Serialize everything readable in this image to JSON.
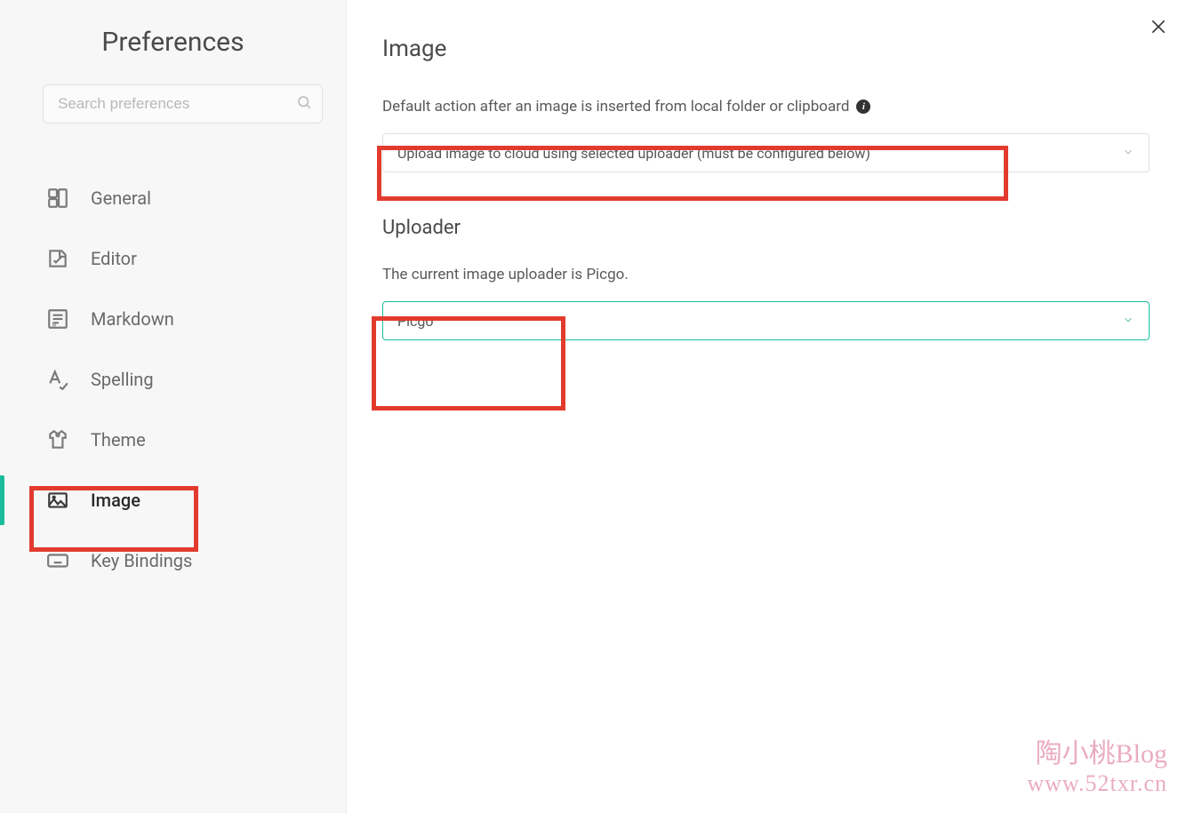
{
  "sidebar": {
    "title": "Preferences",
    "search_placeholder": "Search preferences",
    "items": [
      {
        "label": "General"
      },
      {
        "label": "Editor"
      },
      {
        "label": "Markdown"
      },
      {
        "label": "Spelling"
      },
      {
        "label": "Theme"
      },
      {
        "label": "Image"
      },
      {
        "label": "Key Bindings"
      }
    ]
  },
  "main": {
    "title": "Image",
    "default_action_label": "Default action after an image is inserted from local folder or clipboard",
    "default_action_value": "Upload image to cloud using selected uploader (must be configured below)",
    "uploader_title": "Uploader",
    "uploader_current_label": "The current image uploader is Picgo.",
    "uploader_value": "Picgo"
  },
  "watermark": {
    "line1": "陶小桃Blog",
    "line2": "www.52txr.cn"
  }
}
